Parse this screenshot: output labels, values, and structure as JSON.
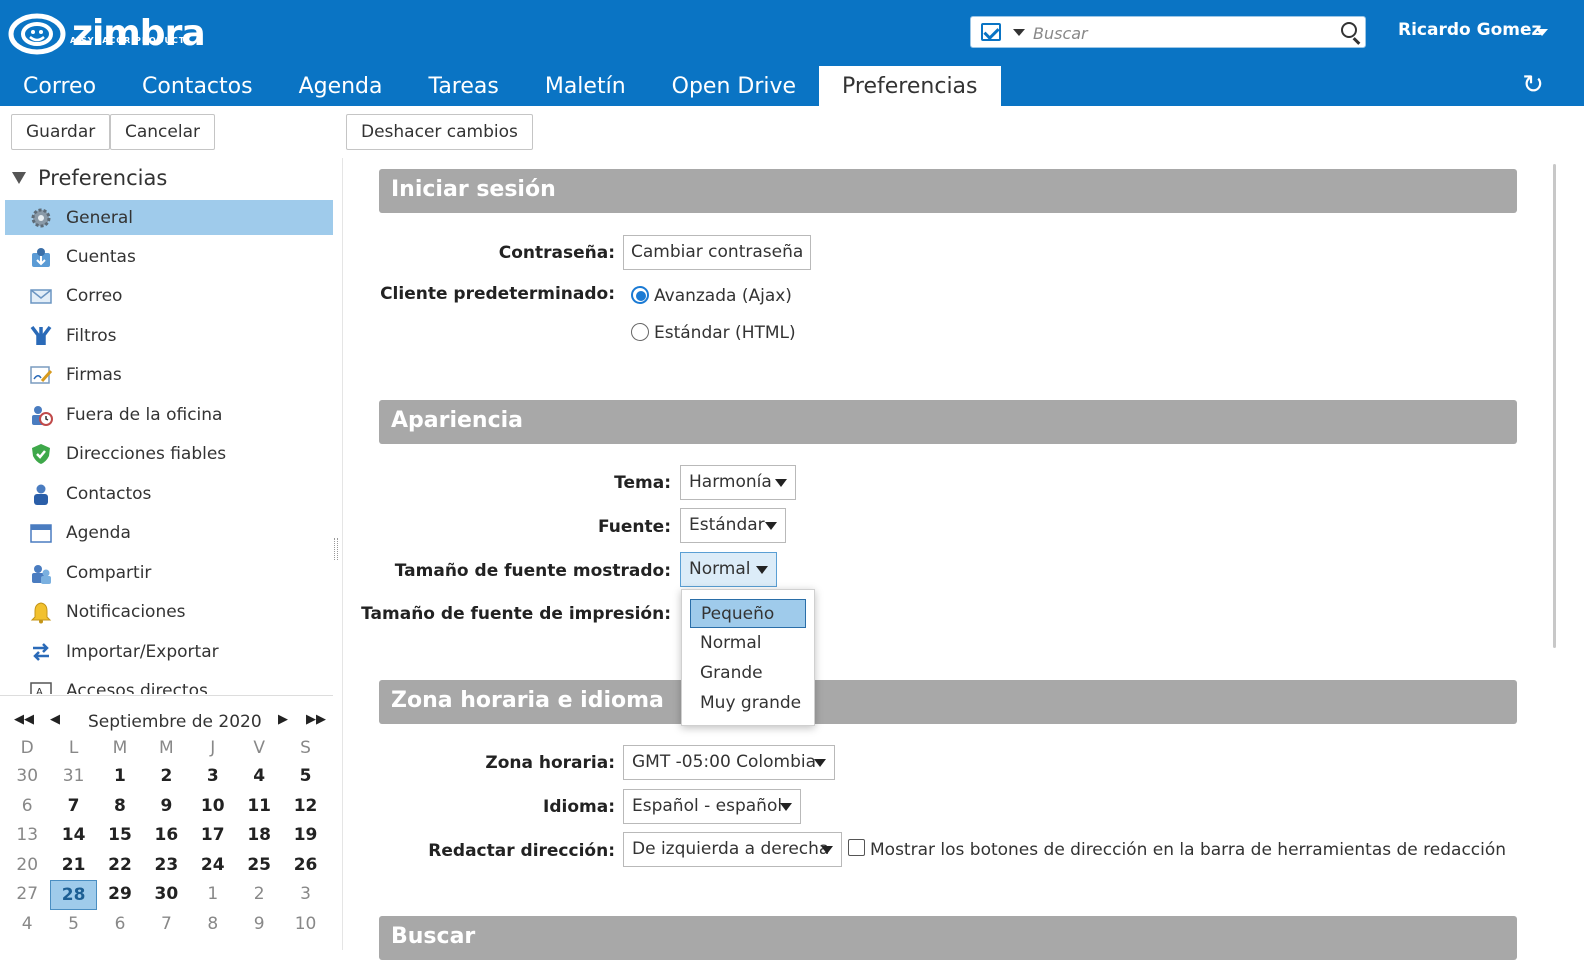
{
  "header": {
    "logo_text": "zimbra",
    "logo_sub": "A SYNACOR PRODUCT",
    "search_placeholder": "Buscar",
    "user_name": "Ricardo Gomez"
  },
  "app_tabs": [
    "Correo",
    "Contactos",
    "Agenda",
    "Tareas",
    "Maletín",
    "Open Drive",
    "Preferencias"
  ],
  "active_tab": "Preferencias",
  "toolbar": {
    "save": "Guardar",
    "cancel": "Cancelar",
    "undo": "Deshacer cambios"
  },
  "sidebar": {
    "title": "Preferencias",
    "items": [
      {
        "label": "General",
        "icon": "gear-icon",
        "selected": true
      },
      {
        "label": "Cuentas",
        "icon": "accounts-icon"
      },
      {
        "label": "Correo",
        "icon": "mail-icon"
      },
      {
        "label": "Filtros",
        "icon": "filter-icon"
      },
      {
        "label": "Firmas",
        "icon": "signature-icon"
      },
      {
        "label": "Fuera de la oficina",
        "icon": "out-of-office-icon"
      },
      {
        "label": "Direcciones fiables",
        "icon": "shield-icon"
      },
      {
        "label": "Contactos",
        "icon": "contact-icon"
      },
      {
        "label": "Agenda",
        "icon": "calendar-icon"
      },
      {
        "label": "Compartir",
        "icon": "share-icon"
      },
      {
        "label": "Notificaciones",
        "icon": "bell-icon"
      },
      {
        "label": "Importar/Exportar",
        "icon": "import-export-icon"
      },
      {
        "label": "Accesos directos",
        "icon": "shortcut-icon"
      }
    ]
  },
  "mini_calendar": {
    "title": "Septiembre de 2020",
    "days_of_week": [
      "D",
      "L",
      "M",
      "M",
      "J",
      "V",
      "S"
    ],
    "weeks": [
      [
        "30",
        "31",
        "1",
        "2",
        "3",
        "4",
        "5"
      ],
      [
        "6",
        "7",
        "8",
        "9",
        "10",
        "11",
        "12"
      ],
      [
        "13",
        "14",
        "15",
        "16",
        "17",
        "18",
        "19"
      ],
      [
        "20",
        "21",
        "22",
        "23",
        "24",
        "25",
        "26"
      ],
      [
        "27",
        "28",
        "29",
        "30",
        "1",
        "2",
        "3"
      ],
      [
        "4",
        "5",
        "6",
        "7",
        "8",
        "9",
        "10"
      ]
    ],
    "today": "28"
  },
  "sections": {
    "login": {
      "title": "Iniciar sesión",
      "password_label": "Contraseña:",
      "password_button": "Cambiar contraseña",
      "client_label": "Cliente predeterminado:",
      "client_options": [
        "Avanzada (Ajax)",
        "Estándar (HTML)"
      ],
      "client_selected": "Avanzada (Ajax)"
    },
    "appearance": {
      "title": "Apariencia",
      "theme_label": "Tema:",
      "theme_value": "Harmonía",
      "font_label": "Fuente:",
      "font_value": "Estándar",
      "display_size_label": "Tamaño de fuente mostrado:",
      "display_size_value": "Normal",
      "print_size_label": "Tamaño de fuente de impresión:",
      "size_options": [
        "Pequeño",
        "Normal",
        "Grande",
        "Muy grande"
      ],
      "size_highlighted": "Pequeño"
    },
    "timezone": {
      "title": "Zona horaria e idioma",
      "tz_label": "Zona horaria:",
      "tz_value": "GMT -05:00 Colombia",
      "lang_label": "Idioma:",
      "lang_value": "Español - español",
      "dir_label": "Redactar dirección:",
      "dir_value": "De izquierda a derecha",
      "dir_checkbox_label": "Mostrar los botones de dirección en la barra de herramientas de redacción"
    },
    "search": {
      "title": "Buscar"
    }
  },
  "colors": {
    "brand_blue": "#0a74c4",
    "section_gray": "#a8a8a8",
    "selection_blue": "#9fcbeb"
  }
}
